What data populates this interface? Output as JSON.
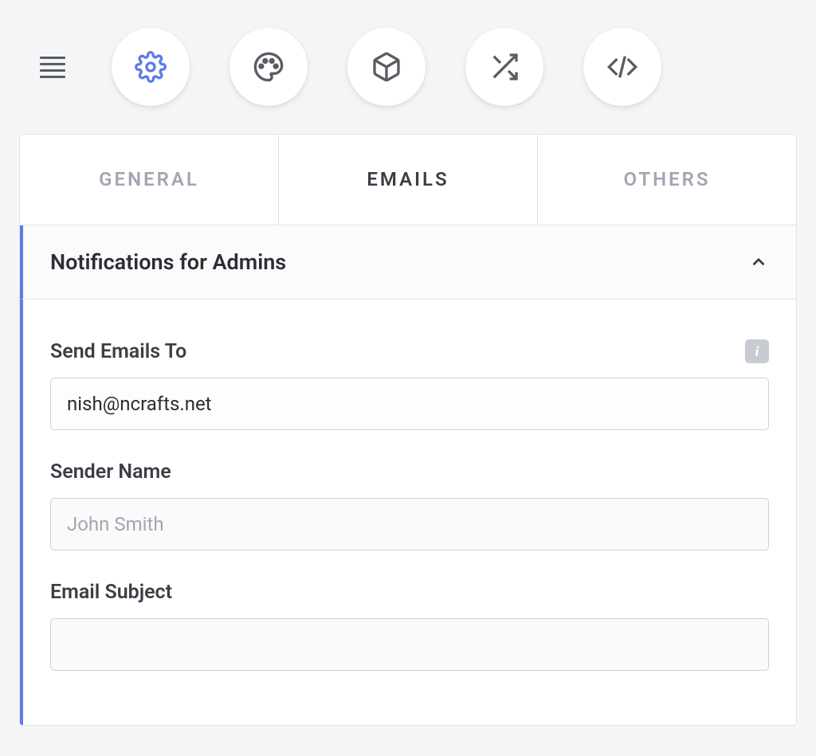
{
  "toolbar": {
    "icons": [
      "gear",
      "palette",
      "cube",
      "shuffle",
      "code"
    ]
  },
  "tabs": [
    {
      "label": "General",
      "active": false
    },
    {
      "label": "Emails",
      "active": true
    },
    {
      "label": "Others",
      "active": false
    }
  ],
  "accordion": {
    "title": "Notifications for Admins",
    "expanded": true
  },
  "fields": {
    "send_to": {
      "label": "Send Emails To",
      "value": "nish@ncrafts.net",
      "has_info": true
    },
    "sender_name": {
      "label": "Sender Name",
      "value": "",
      "placeholder": "John Smith"
    },
    "email_subject": {
      "label": "Email Subject",
      "value": "",
      "placeholder": ""
    }
  }
}
